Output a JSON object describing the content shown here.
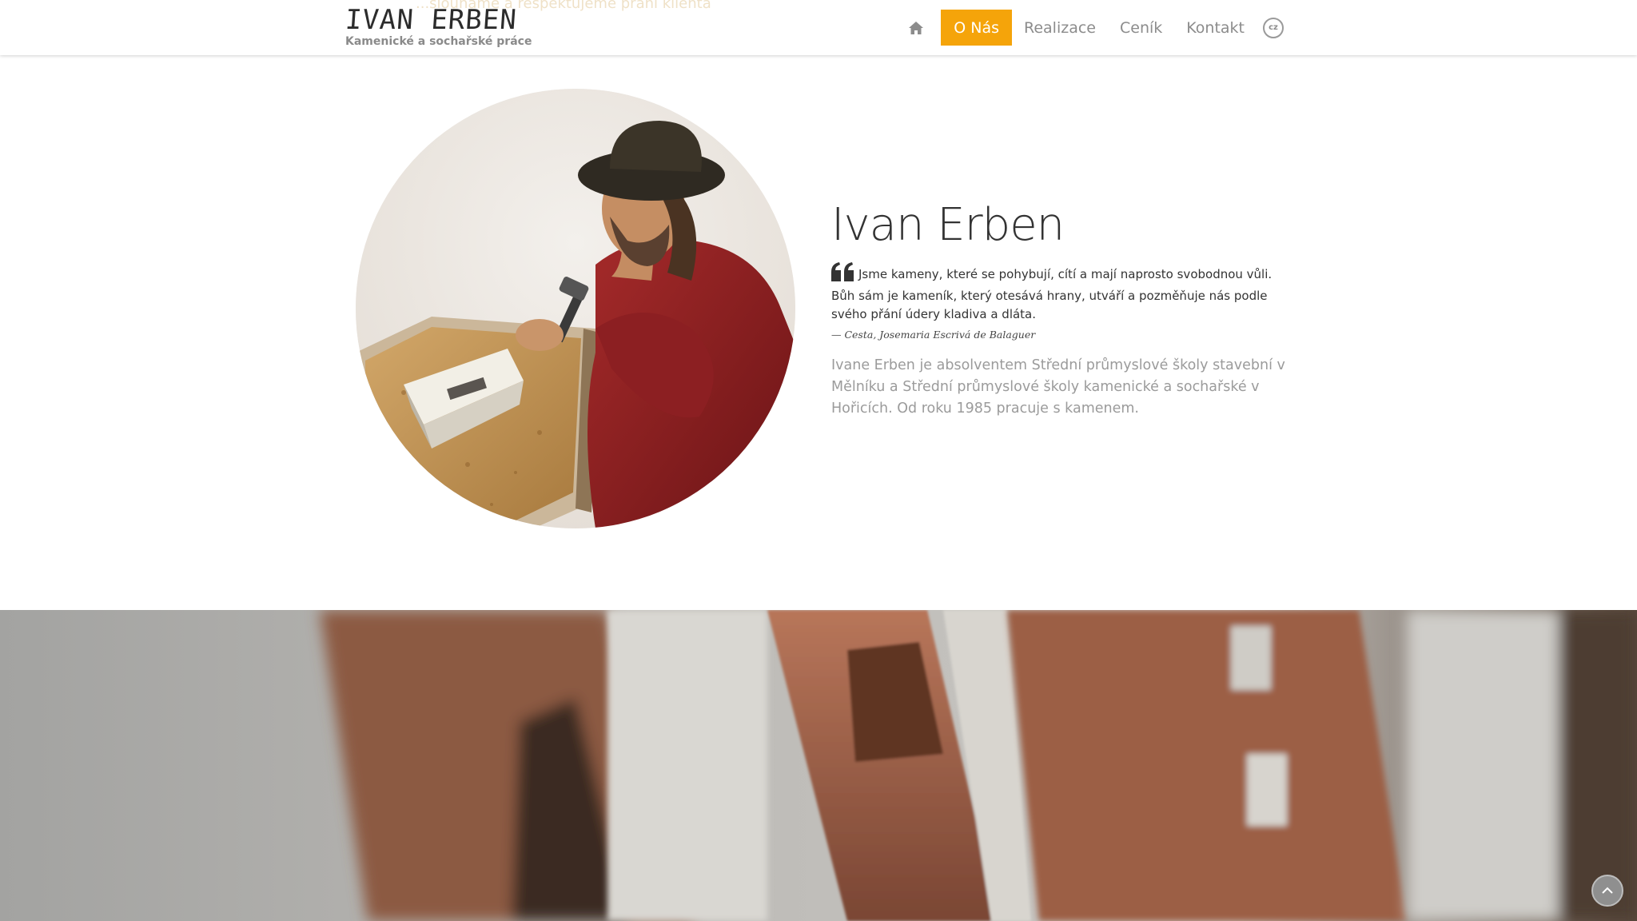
{
  "header": {
    "ghost_text": "...slouháme a respektujeme přání klienta",
    "logo_title": "IVAN ERBEN",
    "logo_subtitle": "Kamenické a sochařské práce"
  },
  "nav": {
    "home_icon": "home-icon",
    "items": [
      {
        "label": "O Nás",
        "active": true
      },
      {
        "label": "Realizace",
        "active": false
      },
      {
        "label": "Ceník",
        "active": false
      },
      {
        "label": "Kontakt",
        "active": false
      }
    ],
    "lang": "cz",
    "accent_color": "#f5a40a"
  },
  "about": {
    "name": "Ivan Erben",
    "quote_icon": "quote-left-icon",
    "quote": "Jsme kameny, které se pohybují, cítí a mají naprosto svobodnou vůli. Bůh sám je kameník, který otesává hrany, utváří a pozměňuje nás podle svého přání údery kladiva a dláta.",
    "quote_author": "— Cesta, Josemaria Escrivá de Balaguer",
    "bio": "Ivane Erben je absolventem Střední průmyslové školy stavební v Mělníku a Střední průmyslové školy kamenické a sochařské v Hořicích. Od roku 1985 pracuje s kamenem."
  },
  "scroll_top_icon": "chevron-up-icon"
}
